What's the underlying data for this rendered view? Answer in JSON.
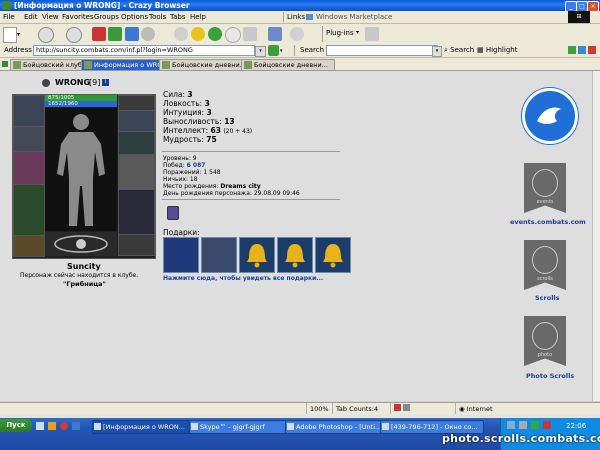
{
  "window": {
    "title": "[Информация о WRONG] - Crazy Browser"
  },
  "menu": [
    "File",
    "Edit",
    "View",
    "Favorites",
    "Groups",
    "Options",
    "Tools",
    "Tabs",
    "Help"
  ],
  "links_bar": {
    "label": "Links",
    "item": "Windows Marketplace"
  },
  "toolbar": {
    "plugins_label": "Plug-ins"
  },
  "address": {
    "label": "Address",
    "url": "http://suncity.combats.com/inf.pl?login=WRONG",
    "search_label": "Search",
    "search_button": "Search",
    "highlight_button": "Highlight"
  },
  "tabs": [
    {
      "label": "Бойцовский клуб",
      "active": false
    },
    {
      "label": "Информация о WRONG",
      "active": true
    },
    {
      "label": "Бойцовские дневни...",
      "active": false
    },
    {
      "label": "Бойцовские дневни...",
      "active": false
    }
  ],
  "character": {
    "name": "WRONG",
    "level": "[9]",
    "hp": "875/1005",
    "mana": "1652/1960",
    "city": "Suncity",
    "location_text": "Персонаж сейчас находится в клубе.",
    "location_room": "\"Грибница\""
  },
  "stats": [
    {
      "label": "Сила:",
      "value": "3",
      "extra": ""
    },
    {
      "label": "Ловкость:",
      "value": "3",
      "extra": ""
    },
    {
      "label": "Интуиция:",
      "value": "3",
      "extra": ""
    },
    {
      "label": "Выносливость:",
      "value": "13",
      "extra": ""
    },
    {
      "label": "Интеллект:",
      "value": "63",
      "extra": "(20 + 43)"
    },
    {
      "label": "Мудрость:",
      "value": "75",
      "extra": ""
    }
  ],
  "info": [
    {
      "label": "Уровень:",
      "value": "9"
    },
    {
      "label": "Побед:",
      "value": "6 087"
    },
    {
      "label": "Поражений:",
      "value": "1 548"
    },
    {
      "label": "Ничьих:",
      "value": "18"
    },
    {
      "label": "Место рождения:",
      "value": "Dreams city"
    },
    {
      "label": "День рождения персонажа:",
      "value": "29.08.09 09:46"
    }
  ],
  "gifts": {
    "label": "Подарки:",
    "link": "Нажмите сюда, чтобы увидеть все подарки..."
  },
  "sidebar_links": [
    "events.combats.com",
    "Scrolls",
    "Photo Scrolls"
  ],
  "sidebar_banner_text": [
    "events",
    "scrolls",
    "photo"
  ],
  "status": {
    "zoom": "100%",
    "tab_counts": "Tab Counts:4",
    "zone": "Internet"
  },
  "taskbar": {
    "start": "Пуск",
    "tasks": [
      {
        "label": "[Информация о WRON...",
        "active": true
      },
      {
        "label": "Skype™ - gjgrf-gjgrf",
        "active": false
      },
      {
        "label": "Adobe Photoshop - [Unti...",
        "active": false
      },
      {
        "label": "[439-796-712] - Окно со...",
        "active": false
      }
    ],
    "clock": "22:06"
  },
  "watermark": "photo.scrolls.combats.com",
  "colors": {
    "accent_blue": "#1f6fd6",
    "link_blue": "#1a3f9a",
    "hp_green": "#2f9a2f",
    "mana_blue": "#2a66d8"
  }
}
